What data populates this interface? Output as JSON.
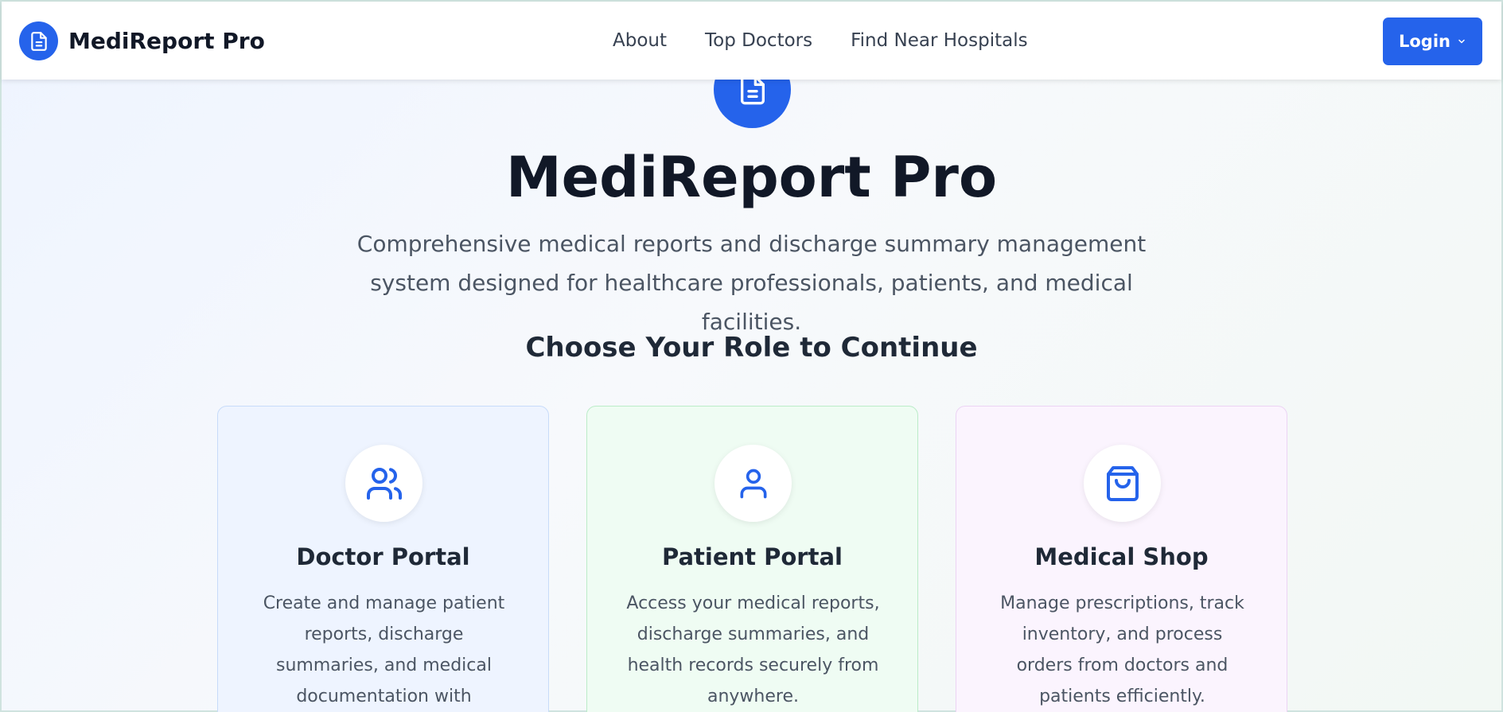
{
  "nav": {
    "brand": "MediReport Pro",
    "links": [
      "About",
      "Top Doctors",
      "Find Near Hospitals"
    ],
    "login_label": "Login"
  },
  "hero": {
    "title": "MediReport Pro",
    "subtitle": "Comprehensive medical reports and discharge summary management system designed for healthcare professionals, patients, and medical facilities.",
    "role_heading": "Choose Your Role to Continue"
  },
  "roles": [
    {
      "title": "Doctor Portal",
      "description": "Create and manage patient reports, discharge summaries, and medical documentation with comprehensive tools.",
      "icon": "users-icon"
    },
    {
      "title": "Patient Portal",
      "description": "Access your medical reports, discharge summaries, and health records securely from anywhere.",
      "icon": "user-icon"
    },
    {
      "title": "Medical Shop",
      "description": "Manage prescriptions, track inventory, and process orders from doctors and patients efficiently.",
      "icon": "shopping-bag-icon"
    }
  ],
  "colors": {
    "primary": "#2563eb",
    "doctor_card_bg": "#eef4ff",
    "patient_card_bg": "#effcf3",
    "shop_card_bg": "#fbf4fe"
  }
}
